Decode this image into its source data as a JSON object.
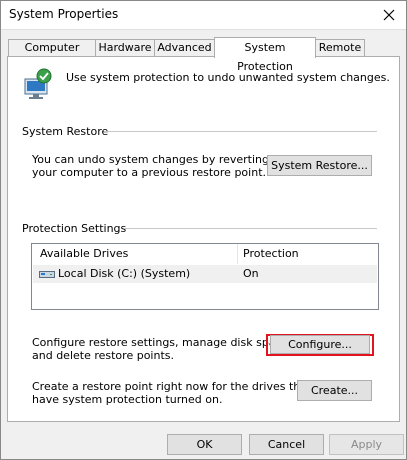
{
  "window": {
    "title": "System Properties"
  },
  "tabs": [
    {
      "label": "Computer Name"
    },
    {
      "label": "Hardware"
    },
    {
      "label": "Advanced"
    },
    {
      "label": "System Protection",
      "active": true
    },
    {
      "label": "Remote"
    }
  ],
  "intro": {
    "text": "Use system protection to undo unwanted system changes."
  },
  "system_restore": {
    "group_label": "System Restore",
    "description_line1": "You can undo system changes by reverting",
    "description_line2": "your computer to a previous restore point.",
    "button_label": "System Restore..."
  },
  "protection": {
    "group_label": "Protection Settings",
    "columns": [
      "Available Drives",
      "Protection"
    ],
    "drives": [
      {
        "name": "Local Disk (C:) (System)",
        "protection": "On"
      }
    ],
    "configure_line1": "Configure restore settings, manage disk space,",
    "configure_line2": "and delete restore points.",
    "configure_button": "Configure...",
    "create_line1": "Create a restore point right now for the drives that",
    "create_line2": "have system protection turned on.",
    "create_button": "Create..."
  },
  "footer": {
    "ok_label": "OK",
    "cancel_label": "Cancel",
    "apply_label": "Apply"
  },
  "colors": {
    "highlight": "#e2141f",
    "panel_background": "#ffffff",
    "window_background": "#f0f0f0"
  },
  "icons": [
    "close-icon",
    "system-protection-shield-icon",
    "drive-icon"
  ]
}
